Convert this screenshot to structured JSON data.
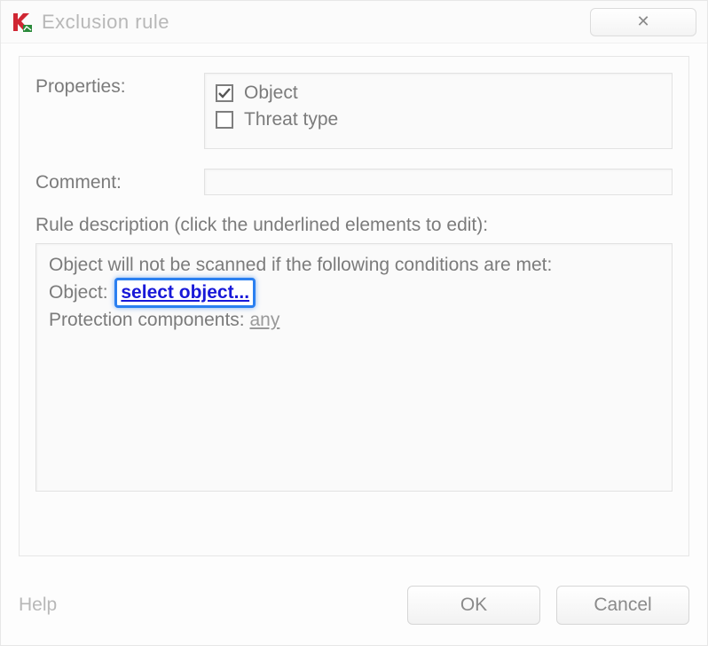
{
  "title": "Exclusion rule",
  "close_glyph": "✕",
  "labels": {
    "properties": "Properties:",
    "comment": "Comment:",
    "rule_description": "Rule description (click the underlined elements to edit):"
  },
  "properties": {
    "object": {
      "label": "Object",
      "checked": true
    },
    "threat_type": {
      "label": "Threat type",
      "checked": false
    }
  },
  "comment_value": "",
  "description": {
    "line1": "Object will not be scanned if the following conditions are met:",
    "object_prefix": "Object:",
    "object_link": "select object...",
    "protection_prefix": "Protection components:",
    "protection_link": "any"
  },
  "footer": {
    "help": "Help",
    "ok": "OK",
    "cancel": "Cancel"
  }
}
